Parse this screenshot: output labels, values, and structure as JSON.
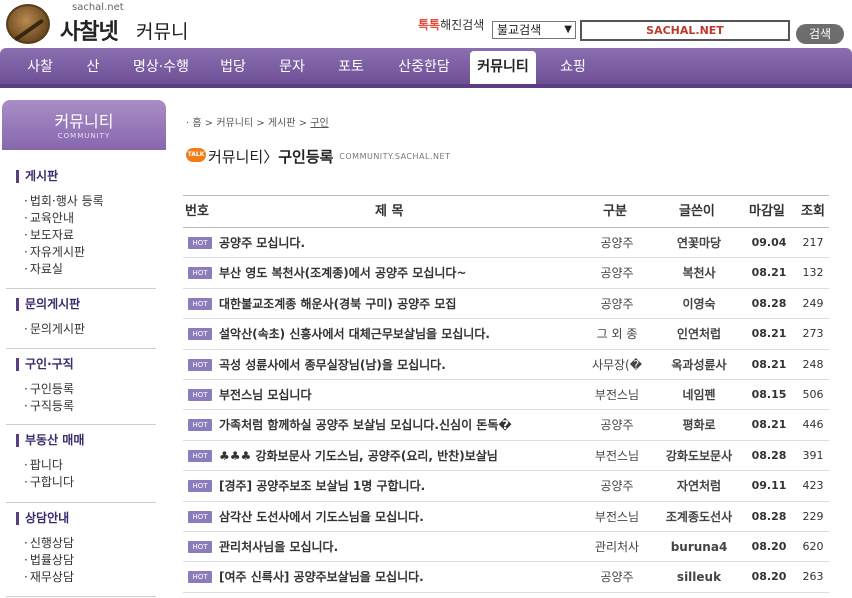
{
  "header": {
    "logo_small": "sachal.net",
    "logo_main": "사찰넷",
    "logo_sub": "커뮤니티",
    "haejin_icon": "톡톡",
    "haejin_label": "해진검색",
    "search_select": "불교검색",
    "search_value": "SACHAL.NET",
    "search_button": "검색"
  },
  "nav": [
    "사찰",
    "산",
    "명상·수행",
    "법당",
    "문자",
    "포토",
    "산중한담",
    "커뮤니티",
    "쇼핑"
  ],
  "nav_active": "커뮤니티",
  "sidebar": {
    "banner_title": "커뮤니티",
    "banner_sub": "COMMUNITY",
    "sections": [
      {
        "title": "게시판",
        "items": [
          "법회·행사 등록",
          "교육안내",
          "보도자료",
          "자유게시판",
          "자료실"
        ]
      },
      {
        "title": "문의게시판",
        "items": [
          "문의게시판"
        ]
      },
      {
        "title": "구인·구직",
        "items": [
          "구인등록",
          "구직등록"
        ]
      },
      {
        "title": "부동산 매매",
        "items": [
          "팝니다",
          "구합니다"
        ]
      },
      {
        "title": "상담안내",
        "items": [
          "신행상담",
          "법률상담",
          "재무상담"
        ]
      }
    ]
  },
  "breadcrumb": {
    "home": "홈",
    "sep": ">",
    "l1": "커뮤니티",
    "l2": "게시판",
    "l3": "구인"
  },
  "page_head": {
    "talk": "TALK",
    "title_a": "커뮤니티",
    "sep": "〉",
    "title_b": "구인등록",
    "sub": "COMMUNITY.SACHAL.NET"
  },
  "table": {
    "headers": {
      "no": "번호",
      "title": "제    목",
      "cat": "구분",
      "writer": "글쓴이",
      "date": "마감일",
      "views": "조회"
    },
    "hot_label": "HOT",
    "rows": [
      {
        "title": "공양주 모십니다.",
        "cat": "공양주",
        "writer": "연꽃마당",
        "date": "09.04",
        "views": "217"
      },
      {
        "title": "부산 영도 복천사(조계종)에서 공양주 모십니다~",
        "cat": "공양주",
        "writer": "복천사",
        "date": "08.21",
        "views": "132"
      },
      {
        "title": "대한불교조계종 해운사(경북 구미) 공양주 모집",
        "cat": "공양주",
        "writer": "이영숙",
        "date": "08.28",
        "views": "249"
      },
      {
        "title": "설악산(속초) 신흥사에서 대체근무보살님을 모십니다.",
        "cat": "그 외 종",
        "writer": "인연처럽",
        "date": "08.21",
        "views": "273"
      },
      {
        "title": "곡성 성륜사에서 종무실장님(남)을 모십니다.",
        "cat": "사무장(�",
        "writer": "옥과성륜사",
        "date": "08.21",
        "views": "248"
      },
      {
        "title": "부전스님 모십니다",
        "cat": "부전스님",
        "writer": "네임펜",
        "date": "08.15",
        "views": "506"
      },
      {
        "title": "가족처럼 함께하실 공양주 보살님 모십니다.신심이 돈독�",
        "cat": "공양주",
        "writer": "평화로",
        "date": "08.21",
        "views": "446"
      },
      {
        "title": "♣♣♣ 강화보문사 기도스님, 공양주(요리, 반찬)보살님",
        "cat": "부전스님",
        "writer": "강화도보문사",
        "date": "08.28",
        "views": "391"
      },
      {
        "title": "[경주] 공양주보조 보살님 1명 구합니다.",
        "cat": "공양주",
        "writer": "자연처럼",
        "date": "09.11",
        "views": "423"
      },
      {
        "title": "삼각산 도선사에서 기도스님을 모십니다.",
        "cat": "부전스님",
        "writer": "조계종도선사",
        "date": "08.28",
        "views": "229"
      },
      {
        "title": "관리처사님을 모십니다.",
        "cat": "관리처사",
        "writer": "buruna4",
        "date": "08.20",
        "views": "620"
      },
      {
        "title": "[여주 신륵사] 공양주보살님을 모십니다.",
        "cat": "공양주",
        "writer": "silleuk",
        "date": "08.20",
        "views": "263"
      }
    ]
  }
}
